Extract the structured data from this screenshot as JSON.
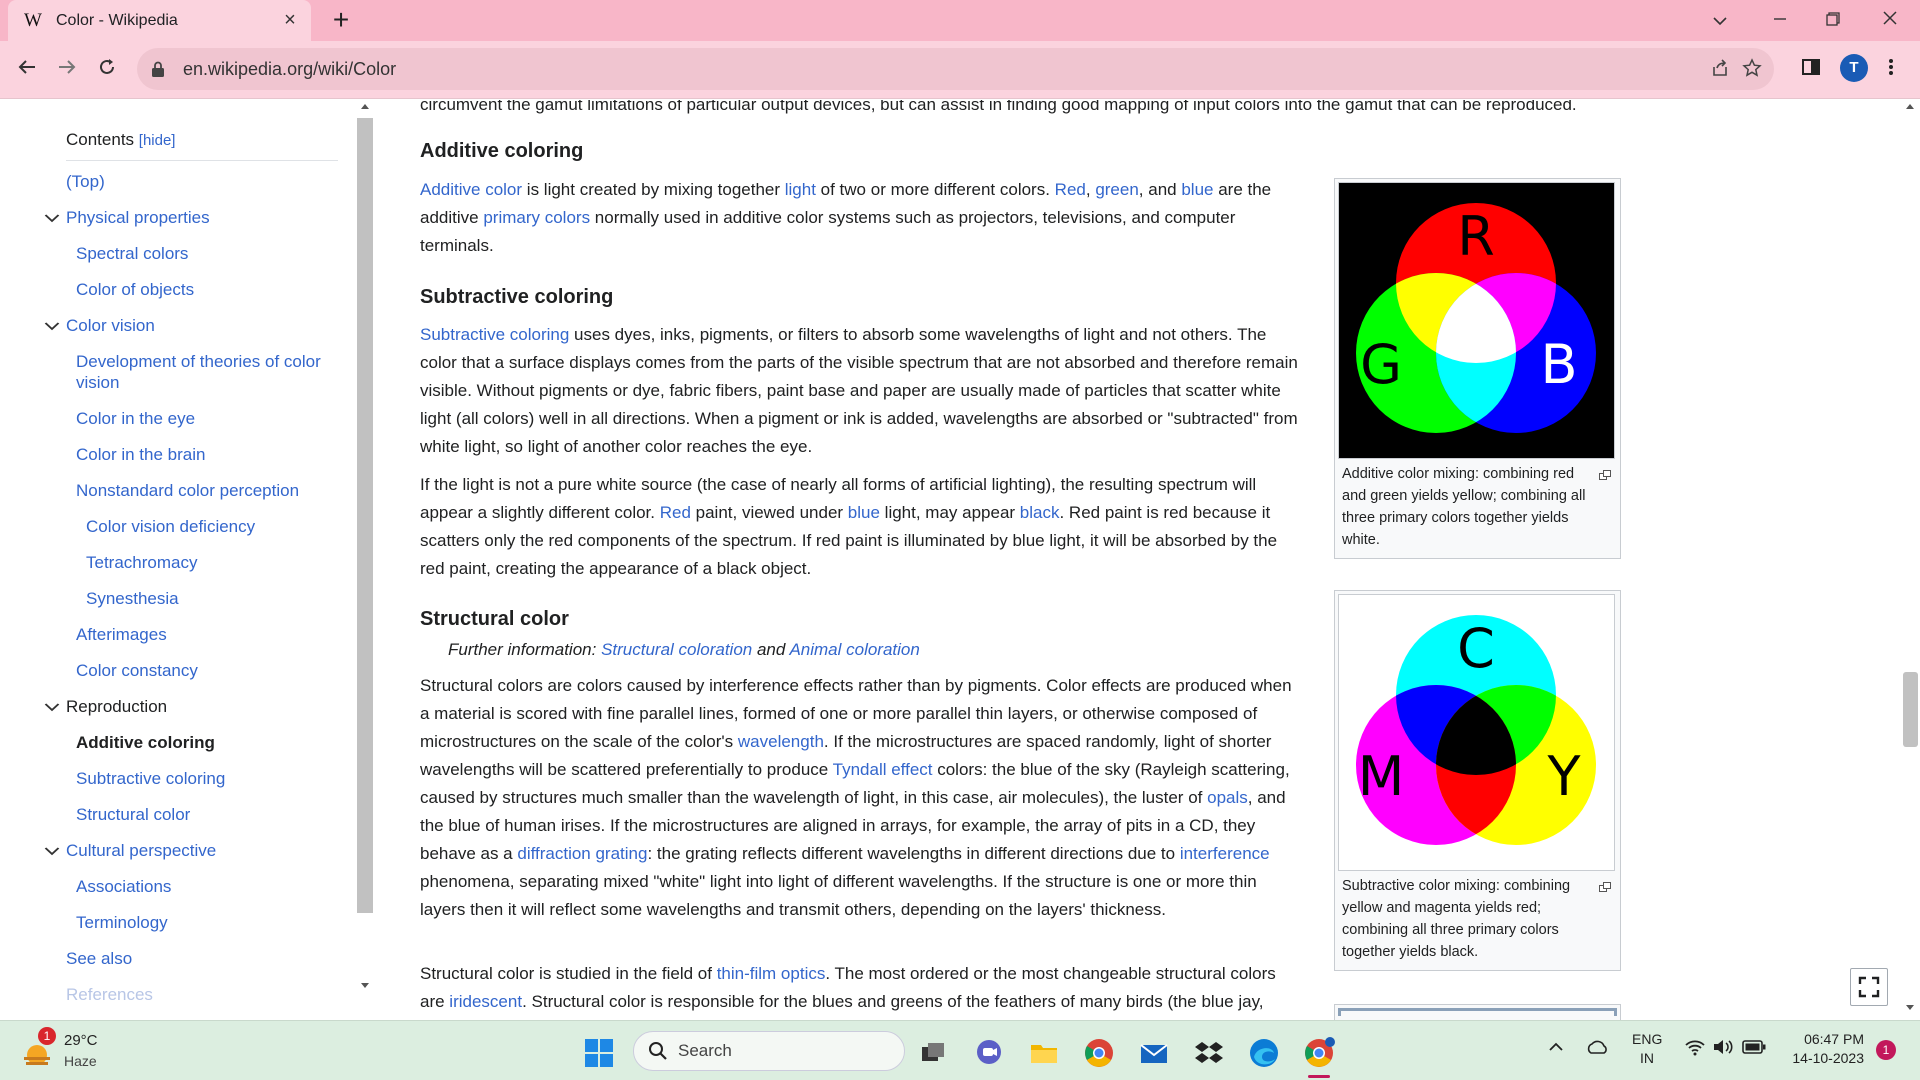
{
  "browser": {
    "tab_title": "Color - Wikipedia",
    "tab_favicon": "W",
    "url": "en.wikipedia.org/wiki/Color",
    "profile_initial": "T"
  },
  "toc": {
    "header": "Contents",
    "hide_label": "[hide]",
    "items": [
      {
        "label": "(Top)",
        "level": 1
      },
      {
        "label": "Physical properties",
        "level": 1,
        "chevron": true
      },
      {
        "label": "Spectral colors",
        "level": 2
      },
      {
        "label": "Color of objects",
        "level": 2
      },
      {
        "label": "Color vision",
        "level": 1,
        "chevron": true
      },
      {
        "label": "Development of theories of color vision",
        "level": 2
      },
      {
        "label": "Color in the eye",
        "level": 2
      },
      {
        "label": "Color in the brain",
        "level": 2
      },
      {
        "label": "Nonstandard color perception",
        "level": 2
      },
      {
        "label": "Color vision deficiency",
        "level": 3
      },
      {
        "label": "Tetrachromacy",
        "level": 3
      },
      {
        "label": "Synesthesia",
        "level": 3
      },
      {
        "label": "Afterimages",
        "level": 2
      },
      {
        "label": "Color constancy",
        "level": 2
      },
      {
        "label": "Reproduction",
        "level": 1,
        "chevron": true,
        "dark": true
      },
      {
        "label": "Additive coloring",
        "level": 2,
        "active": true
      },
      {
        "label": "Subtractive coloring",
        "level": 2
      },
      {
        "label": "Structural color",
        "level": 2
      },
      {
        "label": "Cultural perspective",
        "level": 1,
        "chevron": true
      },
      {
        "label": "Associations",
        "level": 2
      },
      {
        "label": "Terminology",
        "level": 2
      },
      {
        "label": "See also",
        "level": 1
      },
      {
        "label": "References",
        "level": 1,
        "faded": true
      }
    ]
  },
  "article": {
    "top_line": "circumvent the gamut limitations of particular output devices, but can assist in finding good mapping of input colors into the gamut that can be reproduced.",
    "h_additive": "Additive coloring",
    "p_additive": [
      {
        "t": "Additive color",
        "link": true
      },
      {
        "t": " is light created by mixing together "
      },
      {
        "t": "light",
        "link": true
      },
      {
        "t": " of two or more different colors. "
      },
      {
        "t": "Red",
        "link": true
      },
      {
        "t": ", "
      },
      {
        "t": "green",
        "link": true
      },
      {
        "t": ", and "
      },
      {
        "t": "blue",
        "link": true
      },
      {
        "t": " are the additive "
      },
      {
        "t": "primary colors",
        "link": true
      },
      {
        "t": " normally used in additive color systems such as projectors, televisions, and computer terminals."
      }
    ],
    "h_subtractive": "Subtractive coloring",
    "p_subtractive1": [
      {
        "t": "Subtractive coloring",
        "link": true
      },
      {
        "t": " uses dyes, inks, pigments, or filters to absorb some wavelengths of light and not others. The color that a surface displays comes from the parts of the visible spectrum that are not absorbed and therefore remain visible. Without pigments or dye, fabric fibers, paint base and paper are usually made of particles that scatter white light (all colors) well in all directions. When a pigment or ink is added, wavelengths are absorbed or \"subtracted\" from white light, so light of another color reaches the eye."
      }
    ],
    "p_subtractive2": [
      {
        "t": "If the light is not a pure white source (the case of nearly all forms of artificial lighting), the resulting spectrum will appear a slightly different color. "
      },
      {
        "t": "Red",
        "link": true
      },
      {
        "t": " paint, viewed under "
      },
      {
        "t": "blue",
        "link": true
      },
      {
        "t": " light, may appear "
      },
      {
        "t": "black",
        "link": true
      },
      {
        "t": ". Red paint is red because it scatters only the red components of the spectrum. If red paint is illuminated by blue light, it will be absorbed by the red paint, creating the appearance of a black object."
      }
    ],
    "h_structural": "Structural color",
    "further_info": [
      {
        "t": "Further information: "
      },
      {
        "t": "Structural coloration",
        "link": true
      },
      {
        "t": " and "
      },
      {
        "t": "Animal coloration",
        "link": true
      }
    ],
    "p_structural1": [
      {
        "t": "Structural colors are colors caused by interference effects rather than by pigments. Color effects are produced when a material is scored with fine parallel lines, formed of one or more parallel thin layers, or otherwise composed of microstructures on the scale of the color's "
      },
      {
        "t": "wavelength",
        "link": true
      },
      {
        "t": ". If the microstructures are spaced randomly, light of shorter wavelengths will be scattered preferentially to produce "
      },
      {
        "t": "Tyndall effect",
        "link": true
      },
      {
        "t": " colors: the blue of the sky (Rayleigh scattering, caused by structures much smaller than the wavelength of light, in this case, air molecules), the luster of "
      },
      {
        "t": "opals",
        "link": true
      },
      {
        "t": ", and the blue of human irises. If the microstructures are aligned in arrays, for example, the array of pits in a CD, they behave as a "
      },
      {
        "t": "diffraction grating",
        "link": true
      },
      {
        "t": ": the grating reflects different wavelengths in different directions due to "
      },
      {
        "t": "interference",
        "link": true
      },
      {
        "t": " phenomena, separating mixed \"white\" light into light of different wavelengths. If the structure is one or more thin layers then it will reflect some wavelengths and transmit others, depending on the layers' thickness."
      }
    ],
    "p_structural2": [
      {
        "t": "Structural color is studied in the field of "
      },
      {
        "t": "thin-film optics",
        "link": true
      },
      {
        "t": ". The most ordered or the most changeable structural colors are "
      },
      {
        "t": "iridescent",
        "link": true
      },
      {
        "t": ". Structural color is responsible for the blues and greens of the feathers of many birds (the blue jay,"
      }
    ],
    "fig_additive": {
      "caption": "Additive color mixing: combining red and green yields yellow; combining all three primary colors together yields white.",
      "letters": [
        "R",
        "G",
        "B"
      ]
    },
    "fig_subtractive": {
      "caption": "Subtractive color mixing: combining yellow and magenta yields red; combining all three primary colors together yields black.",
      "letters": [
        "C",
        "M",
        "Y"
      ]
    }
  },
  "taskbar": {
    "weather_temp": "29°C",
    "weather_desc": "Haze",
    "weather_badge": "1",
    "search_placeholder": "Search",
    "lang_top": "ENG",
    "lang_bottom": "IN",
    "time": "06:47 PM",
    "date": "14-10-2023",
    "notif_count": "1"
  },
  "colors": {
    "link": "#3366cc",
    "tab_bar": "#f8b6c8",
    "toolbar": "#fbd3de",
    "taskbar": "#dceee0"
  }
}
